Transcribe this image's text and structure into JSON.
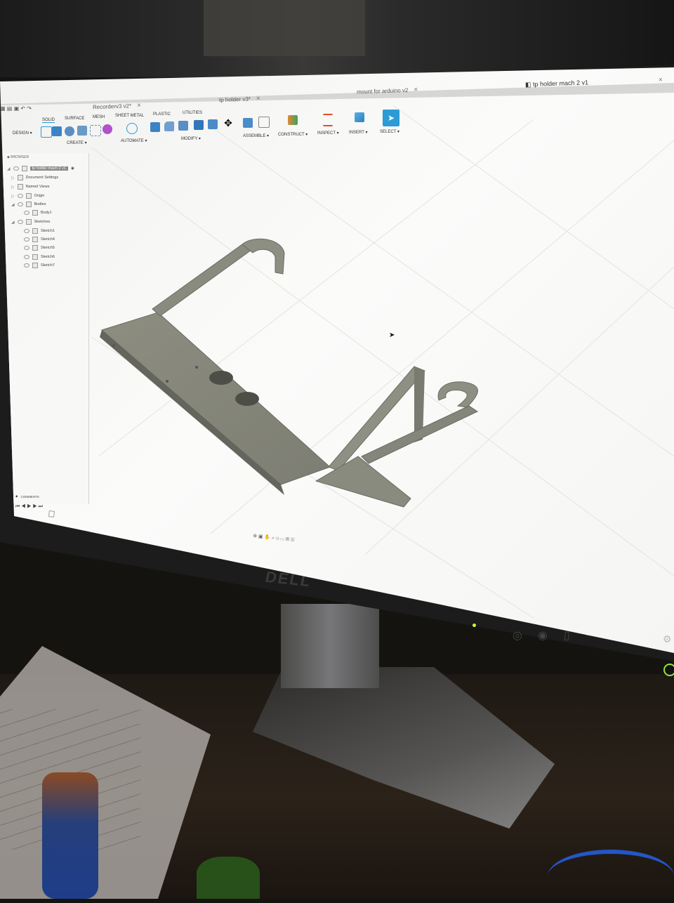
{
  "app": {
    "tabs": [
      {
        "label": "Recorderv3 v2*"
      },
      {
        "label": "tp holder v3*"
      },
      {
        "label": "mount for arduino v2"
      },
      {
        "label": "tp holder mach 2 v1"
      }
    ]
  },
  "toolbar": {
    "workspace": "DESIGN",
    "mode_tabs": [
      "SOLID",
      "SURFACE",
      "MESH",
      "SHEET METAL",
      "PLASTIC",
      "UTILITIES"
    ],
    "groups": [
      "CREATE",
      "AUTOMATE",
      "MODIFY",
      "ASSEMBLE",
      "CONSTRUCT",
      "INSPECT",
      "INSERT",
      "SELECT"
    ]
  },
  "browser": {
    "header": "BROWSER",
    "root": "tp holder mach 2 v1",
    "items": [
      "Document Settings",
      "Named Views",
      "Origin",
      "Bodies",
      "Body1",
      "Sketches",
      "Sketch1",
      "Sketch4",
      "Sketch5",
      "Sketch6",
      "Sketch7"
    ]
  },
  "comments_label": "COMMENTS",
  "monitor": {
    "brand": "DELL"
  },
  "colors": {
    "select_accent": "#2c9bd6",
    "model_body": "#8d8d80"
  }
}
